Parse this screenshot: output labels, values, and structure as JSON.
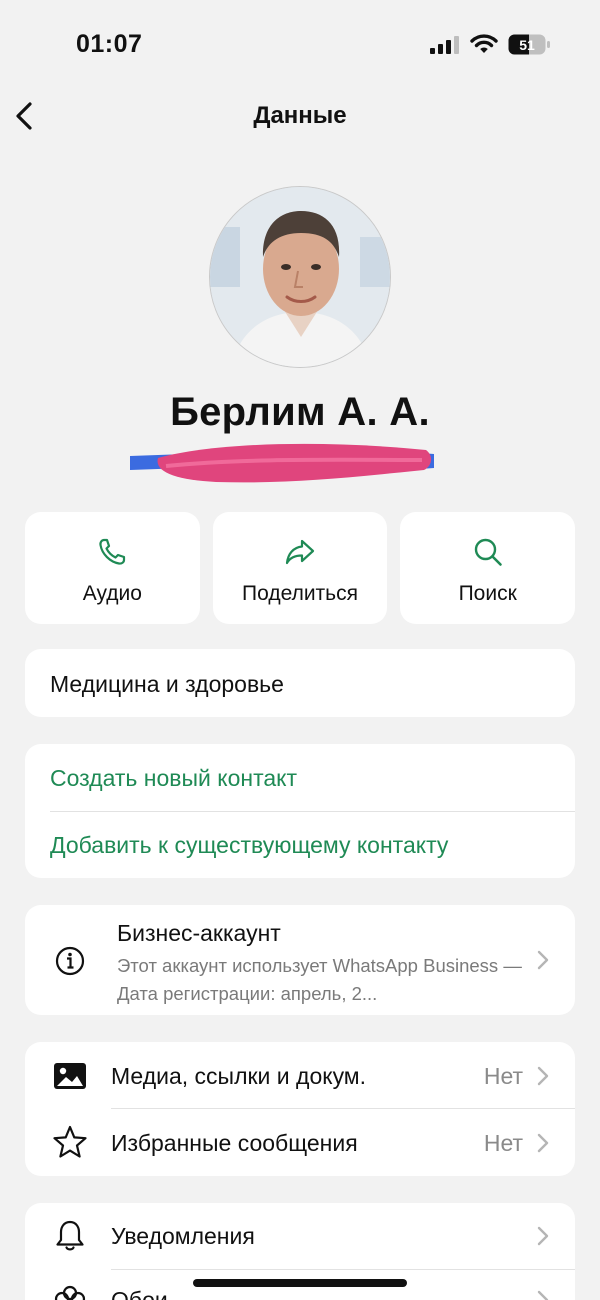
{
  "status_bar": {
    "time": "01:07",
    "battery": "51"
  },
  "nav": {
    "title": "Данные"
  },
  "profile": {
    "name": "Берлим А. А."
  },
  "actions": [
    {
      "label": "Аудио",
      "icon": "phone-icon"
    },
    {
      "label": "Поделиться",
      "icon": "share-icon"
    },
    {
      "label": "Поиск",
      "icon": "search-icon"
    }
  ],
  "category": "Медицина и здоровье",
  "contact_actions": {
    "create": "Создать новый контакт",
    "add_existing": "Добавить к существующему контакту"
  },
  "business": {
    "title": "Бизнес-аккаунт",
    "description": "Этот аккаунт использует WhatsApp Business — Дата регистрации: апрель, 2..."
  },
  "media_rows": [
    {
      "label": "Медиа, ссылки и докум.",
      "value": "Нет",
      "icon": "image-icon"
    },
    {
      "label": "Избранные сообщения",
      "value": "Нет",
      "icon": "star-icon"
    }
  ],
  "notify_rows": [
    {
      "label": "Уведомления",
      "icon": "bell-icon"
    },
    {
      "label": "Обои",
      "icon": "flower-icon"
    }
  ],
  "colors": {
    "accent": "#1f8a55",
    "background": "#f2f2f2",
    "card": "#ffffff"
  }
}
